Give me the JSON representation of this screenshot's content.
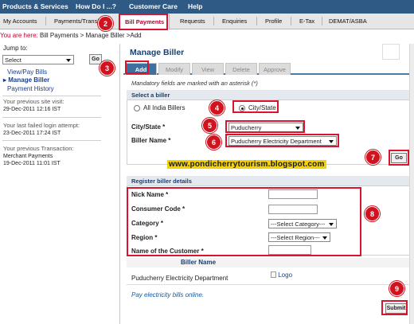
{
  "topnav": {
    "items": [
      "Products & Services",
      "How Do I ...?",
      "Customer Care",
      "Help"
    ]
  },
  "tabs": {
    "items": [
      "My Accounts",
      "Payments/Transf",
      "Bill Payments",
      "Requests",
      "Enquiries",
      "Profile",
      "E-Tax",
      "DEMAT/ASBA"
    ],
    "active": "Bill Payments"
  },
  "breadcrumb": {
    "prefix": "You are here:",
    "path": "Bill Payments > Manage Biller >Add"
  },
  "sidebar": {
    "jump_label": "Jump to:",
    "jump_value": "Select",
    "go_label": "Go",
    "links": [
      "View/Pay Bills",
      "Manage Biller",
      "Payment History"
    ],
    "active_link": "Manage Biller",
    "last_visit_label": "Your previous site visit:",
    "last_visit_value": "29-Dec-2011 12:16 IST",
    "failed_login_label": "Your last failed login attempt:",
    "failed_login_value": "23-Dec-2011 17:24 IST",
    "prev_txn_label": "Your previous Transaction:",
    "prev_txn_type": "Merchant Payments",
    "prev_txn_value": "19-Dec-2011 11:01 IST"
  },
  "main": {
    "title": "Manage Biller",
    "subtabs": [
      "Add",
      "Modify",
      "View",
      "Delete",
      "Approve"
    ],
    "active_subtab": "Add",
    "mandatory_note": "Mandatory fields are marked with an asterisk (*)",
    "select_biller": {
      "header": "Select a biller",
      "option_all": "All India Billers",
      "option_city": "City/State",
      "selected": "City/State",
      "city_label": "City/State *",
      "city_value": "Puducherry",
      "biller_label": "Biller Name *",
      "biller_value": "Puducherry Electricity Department",
      "go_label": "Go"
    },
    "watermark": "www.pondicherrytourism.blogspot.com",
    "register": {
      "header": "Register biller details",
      "fields": [
        "Nick Name *",
        "Consumer Code *",
        "Category *",
        "Region *",
        "Name of the Customer *"
      ],
      "category_value": "---Select Category---",
      "region_value": "---Select Region---"
    },
    "biller_table": {
      "header": "Biller Name",
      "name": "Puducherry Electricity Department",
      "logo": "Logo"
    },
    "pay_link": "Pay electricity bills online.",
    "submit_label": "Submit"
  },
  "annotations": [
    "2",
    "3",
    "4",
    "5",
    "6",
    "7",
    "8",
    "9"
  ],
  "colors": {
    "nav": "#2f5a86",
    "active_tab_text": "#c0002a",
    "highlight": "#d8152c",
    "subtab_active": "#3f6f9e",
    "watermark_bg": "#f4d300"
  }
}
